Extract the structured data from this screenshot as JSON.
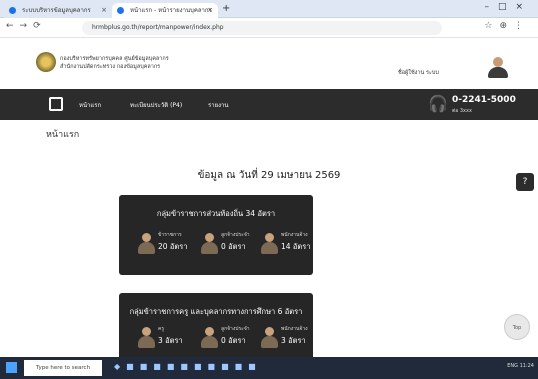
{
  "browser": {
    "tabs": [
      {
        "label": "ระบบบริหารข้อมูลบุคลากร"
      },
      {
        "label": "หน้าแรก - หน้ารายงานบุคลากร"
      }
    ],
    "new_tab": "+",
    "url": "hrmbplus.go.th/report/manpower/index.php"
  },
  "site": {
    "org_line1": "กองบริหารทรัพยากรบุคคล ศูนย์ข้อมูลบุคลากร",
    "org_line2": "สำนักงานปลัดกระทรวง กองข้อมูลบุคลากร",
    "user": "ชื่อผู้ใช้งาน ระบบ"
  },
  "navbar": {
    "items": [
      {
        "label": "หน้าแรก"
      },
      {
        "label": "ทะเบียนประวัติ (P4)"
      },
      {
        "label": "รายงาน"
      }
    ],
    "phone": "0-2241-5000",
    "phone_sub": "ต่อ 3xxx"
  },
  "page_title": "หน้าแรก",
  "as_of": "ข้อมูล ณ วันที่ 29 เมษายน 2569",
  "cards": [
    {
      "title": "กลุ่มข้าราชการส่วนท้องถิ่น 34 อัตรา",
      "cols": [
        {
          "label": "ข้าราชการ",
          "value": "20 อัตรา"
        },
        {
          "label": "ลูกจ้างประจำ",
          "value": "0 อัตรา"
        },
        {
          "label": "พนักงานจ้าง",
          "value": "14 อัตรา"
        }
      ]
    },
    {
      "title": "กลุ่มข้าราชการครู และบุคลากรทางการศึกษา 6 อัตรา",
      "cols": [
        {
          "label": "ครู",
          "value": "3 อัตรา"
        },
        {
          "label": "ลูกจ้างประจำ",
          "value": "0 อัตรา"
        },
        {
          "label": "พนักงานจ้าง",
          "value": "3 อัตรา"
        }
      ]
    }
  ],
  "feedback_label": "?",
  "totop_label": "Top",
  "taskbar": {
    "search_placeholder": "Type here to search",
    "tray_text": "ENG 11:24"
  }
}
